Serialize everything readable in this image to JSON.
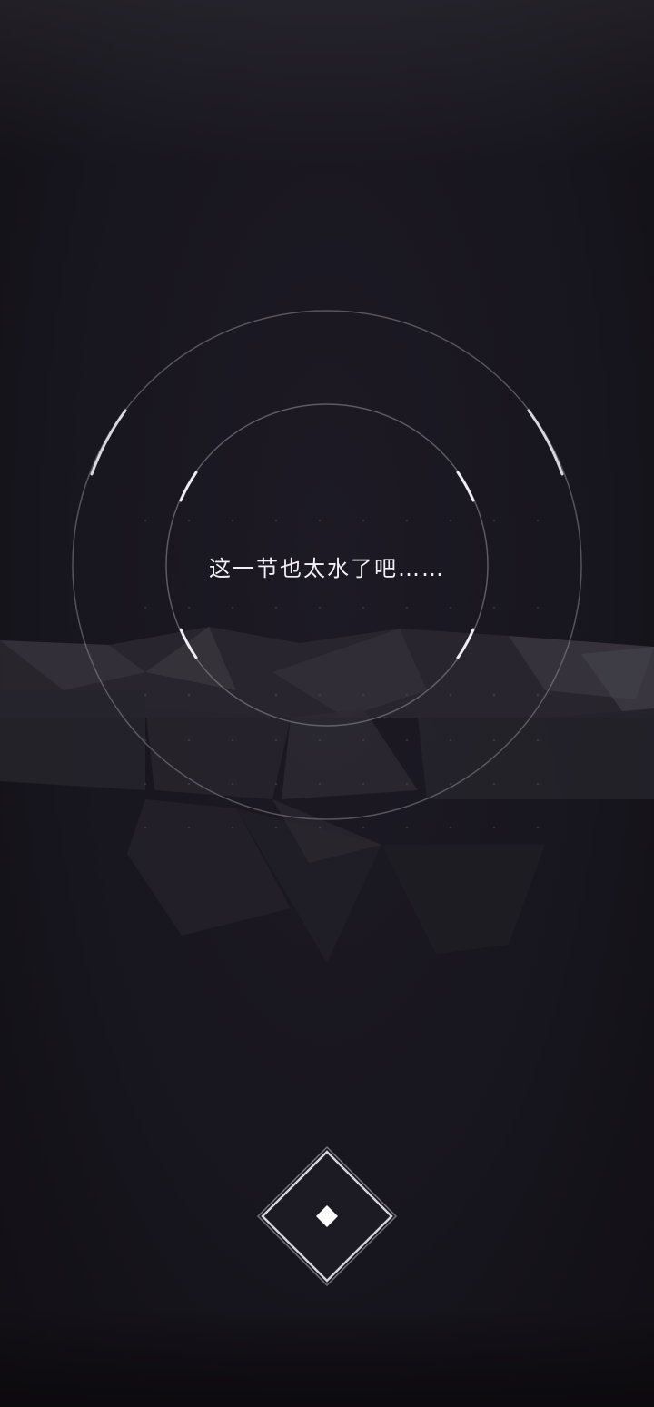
{
  "dialogue": {
    "text": "这一节也太水了吧……"
  },
  "continue_button": {
    "icon": "diamond-icon"
  },
  "colors": {
    "background": "#17151d",
    "ring": "#8a8792",
    "ring_accent": "#e8e6ee",
    "text": "#f2f0f5",
    "button_outline": "#bdbac4",
    "button_fill": "#ffffff"
  }
}
